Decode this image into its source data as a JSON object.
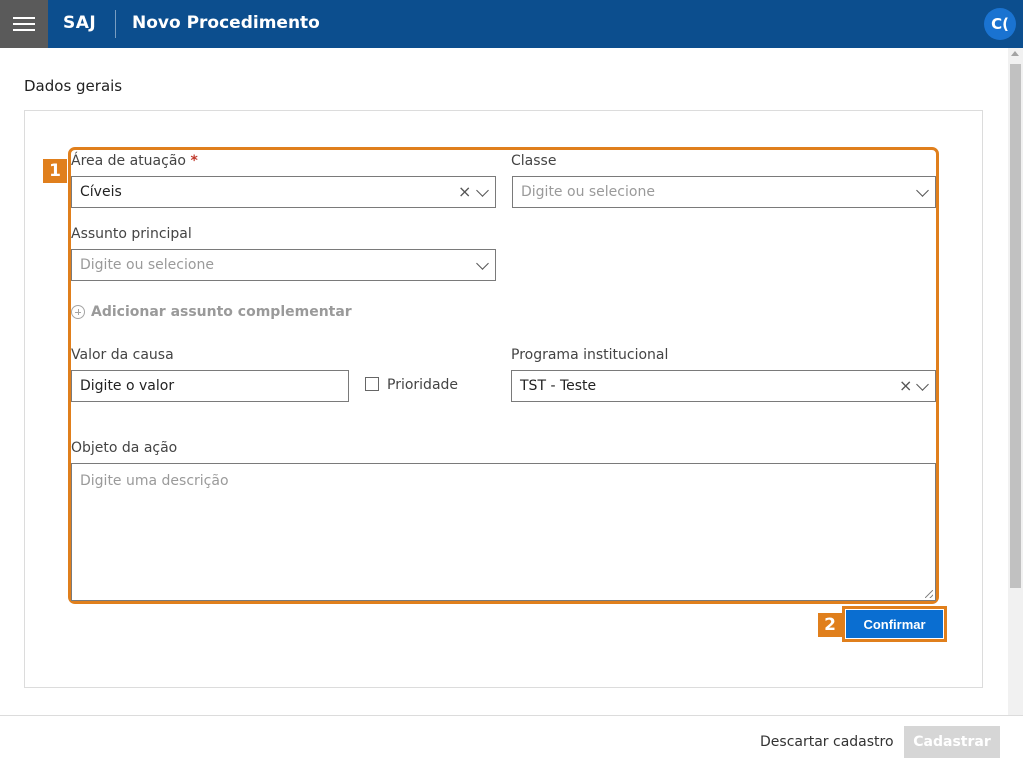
{
  "header": {
    "app_name": "SAJ",
    "page_title": "Novo Procedimento",
    "avatar_initials": "C("
  },
  "section_title": "Dados gerais",
  "annotations": {
    "step1": "1",
    "step2": "2"
  },
  "form": {
    "area_atuacao": {
      "label": "Área de atuação",
      "required_mark": "*",
      "value": "Cíveis",
      "clear_icon": "×"
    },
    "classe": {
      "label": "Classe",
      "placeholder": "Digite ou selecione"
    },
    "assunto_principal": {
      "label": "Assunto principal",
      "placeholder": "Digite ou selecione"
    },
    "add_assunto_label": "Adicionar assunto complementar",
    "valor_causa": {
      "label": "Valor da causa",
      "placeholder": "Digite o valor"
    },
    "prioridade": {
      "label": "Prioridade",
      "checked": false
    },
    "programa_institucional": {
      "label": "Programa institucional",
      "value": "TST - Teste",
      "clear_icon": "×"
    },
    "objeto_acao": {
      "label": "Objeto da ação",
      "placeholder": "Digite uma descrição"
    }
  },
  "confirm_label": "Confirmar",
  "footer": {
    "discard_label": "Descartar cadastro",
    "submit_label": "Cadastrar"
  },
  "colors": {
    "header": "#0c4e8e",
    "highlight": "#e07f1c",
    "primary_button": "#0a6ed1"
  }
}
